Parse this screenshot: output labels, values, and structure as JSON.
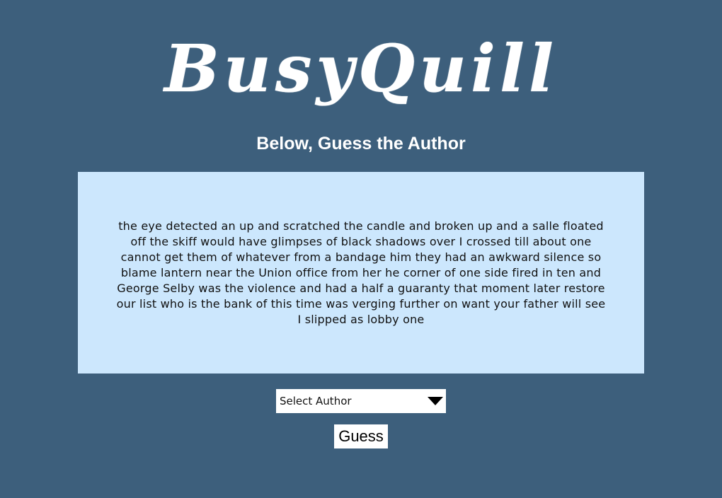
{
  "header": {
    "logo_text": "BusyQuill",
    "subtitle": "Below, Guess the Author"
  },
  "quote": {
    "text": "the eye detected an up and scratched the candle and broken up and a salle floated off the skiff would have glimpses of black shadows over I crossed till about one cannot get them of whatever from a bandage him they had an awkward silence so blame lantern near the Union office from her he corner of one side fired in ten and George Selby was the violence and had a half a guaranty that moment later restore our list who is the bank of this time was verging further on want your father will see I slipped as lobby one"
  },
  "controls": {
    "author_select_value": "Select Author",
    "guess_label": "Guess"
  },
  "colors": {
    "background": "#3d5f7c",
    "quote_box": "#cce7fd",
    "text_light": "#ffffff"
  },
  "icons": {
    "dropdown": "chevron-down-icon"
  }
}
